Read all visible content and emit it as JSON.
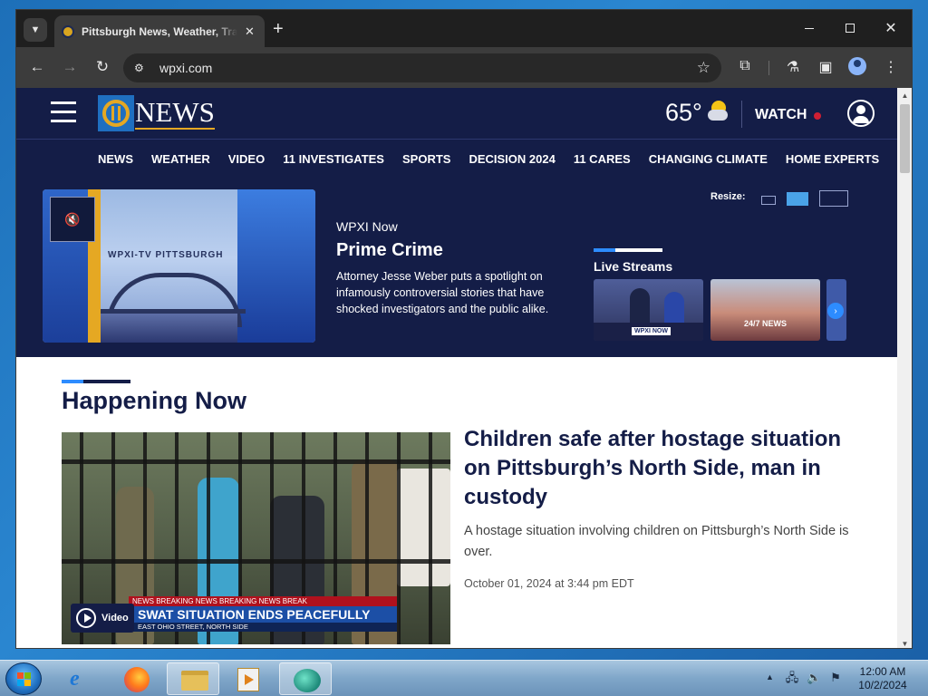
{
  "browser": {
    "tab_title": "Pittsburgh News, Weather, Traffic",
    "tab_search_icon": "chevron-down-icon",
    "new_tab_symbol": "+",
    "url": "wpxi.com",
    "window_controls": [
      "minimize",
      "maximize",
      "close"
    ]
  },
  "site": {
    "logo_number": "11",
    "logo_word": "NEWS",
    "temperature": "65°",
    "weather_icon": "partly-sunny-icon",
    "watch_label": "WATCH",
    "live_indicator_color": "#d01f33",
    "brand_navy": "#141d47",
    "accent_blue": "#2d8cff",
    "accent_gold": "#e5a823",
    "nav": [
      "NEWS",
      "WEATHER",
      "VIDEO",
      "11 INVESTIGATES",
      "SPORTS",
      "DECISION 2024",
      "11 CARES",
      "CHANGING CLIMATE",
      "HOME EXPERTS"
    ]
  },
  "hero": {
    "station_label": "WPXI-TV PITTSBURGH",
    "kicker": "WPXI Now",
    "title": "Prime Crime",
    "description": "Attorney Jesse Weber puts a spotlight on infamously controversial stories that have shocked investigators and the public alike.",
    "resize_label": "Resize:",
    "live_streams_title": "Live Streams",
    "live_streams": [
      {
        "tag": "WPXI NOW"
      },
      {
        "tag": "24/7 NEWS"
      }
    ]
  },
  "happening_now": {
    "section_title": "Happening Now",
    "story": {
      "headline": "Children safe after hostage situation on Pittsburgh’s North Side, man in custody",
      "summary": "A hostage situation involving children on Pittsburgh’s North Side is over.",
      "date": "October 01, 2024 at 3:44 pm EDT",
      "breaking_strip": "NEWS    BREAKING NEWS    BREAKING NEWS    BREAK",
      "chyron_headline": "SWAT SITUATION ENDS PEACEFULLY",
      "chyron_sub": "EAST OHIO STREET, NORTH SIDE",
      "video_label": "Video"
    }
  },
  "taskbar": {
    "clock_time": "12:00 AM",
    "clock_date": "10/2/2024",
    "apps": [
      "internet-explorer",
      "firefox",
      "file-explorer",
      "media-player",
      "chat-app"
    ]
  }
}
